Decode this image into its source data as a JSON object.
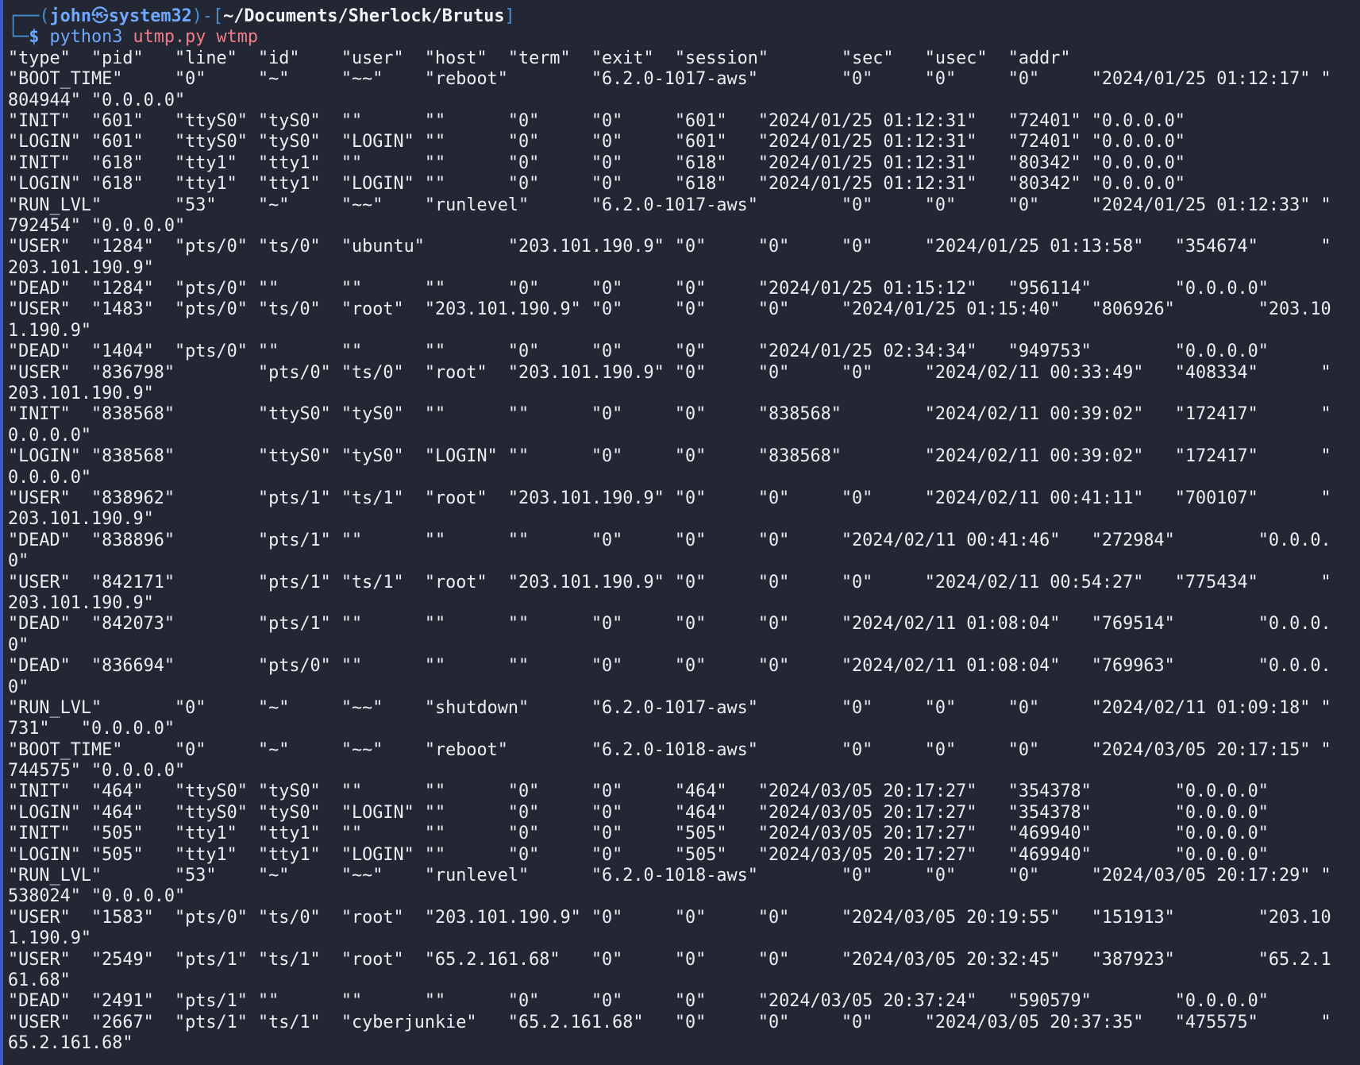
{
  "colors": {
    "background": "#232733",
    "accent_left_border": "#3b58c9",
    "prompt_frame": "#4a8fd0",
    "prompt_user_host": "#6ea8ff",
    "path": "#f2f4f7",
    "command_args": "#f27d8a",
    "output_text": "#eaeef3"
  },
  "prompt": {
    "frame_top_left": "┌──(",
    "user": "john",
    "separator_icon": "㉿",
    "host": "system32",
    "frame_mid": ")-[",
    "path": "~/Documents/Sherlock/Brutus",
    "frame_close": "]",
    "frame_bottom_left": "└─",
    "dollar": "$",
    "command": "python3",
    "arg1": "utmp.py",
    "arg2": "wtmp"
  },
  "output_lines": [
    "\"type\"  \"pid\"   \"line\"  \"id\"    \"user\"  \"host\"  \"term\"  \"exit\"  \"session\"       \"sec\"   \"usec\"  \"addr\"",
    "\"BOOT_TIME\"     \"0\"     \"~\"     \"~~\"    \"reboot\"        \"6.2.0-1017-aws\"        \"0\"     \"0\"     \"0\"     \"2024/01/25 01:12:17\" \"",
    "804944\" \"0.0.0.0\"",
    "\"INIT\"  \"601\"   \"ttyS0\" \"tyS0\"  \"\"      \"\"      \"0\"     \"0\"     \"601\"   \"2024/01/25 01:12:31\"   \"72401\" \"0.0.0.0\"",
    "\"LOGIN\" \"601\"   \"ttyS0\" \"tyS0\"  \"LOGIN\" \"\"      \"0\"     \"0\"     \"601\"   \"2024/01/25 01:12:31\"   \"72401\" \"0.0.0.0\"",
    "\"INIT\"  \"618\"   \"tty1\"  \"tty1\"  \"\"      \"\"      \"0\"     \"0\"     \"618\"   \"2024/01/25 01:12:31\"   \"80342\" \"0.0.0.0\"",
    "\"LOGIN\" \"618\"   \"tty1\"  \"tty1\"  \"LOGIN\" \"\"      \"0\"     \"0\"     \"618\"   \"2024/01/25 01:12:31\"   \"80342\" \"0.0.0.0\"",
    "\"RUN_LVL\"       \"53\"    \"~\"     \"~~\"    \"runlevel\"      \"6.2.0-1017-aws\"        \"0\"     \"0\"     \"0\"     \"2024/01/25 01:12:33\" \"",
    "792454\" \"0.0.0.0\"",
    "\"USER\"  \"1284\"  \"pts/0\" \"ts/0\"  \"ubuntu\"        \"203.101.190.9\" \"0\"     \"0\"     \"0\"     \"2024/01/25 01:13:58\"   \"354674\"      \"",
    "203.101.190.9\"",
    "\"DEAD\"  \"1284\"  \"pts/0\" \"\"      \"\"      \"\"      \"0\"     \"0\"     \"0\"     \"2024/01/25 01:15:12\"   \"956114\"        \"0.0.0.0\"",
    "\"USER\"  \"1483\"  \"pts/0\" \"ts/0\"  \"root\"  \"203.101.190.9\" \"0\"     \"0\"     \"0\"     \"2024/01/25 01:15:40\"   \"806926\"        \"203.10",
    "1.190.9\"",
    "\"DEAD\"  \"1404\"  \"pts/0\" \"\"      \"\"      \"\"      \"0\"     \"0\"     \"0\"     \"2024/01/25 02:34:34\"   \"949753\"        \"0.0.0.0\"",
    "\"USER\"  \"836798\"        \"pts/0\" \"ts/0\"  \"root\"  \"203.101.190.9\" \"0\"     \"0\"     \"0\"     \"2024/02/11 00:33:49\"   \"408334\"      \"",
    "203.101.190.9\"",
    "\"INIT\"  \"838568\"        \"ttyS0\" \"tyS0\"  \"\"      \"\"      \"0\"     \"0\"     \"838568\"        \"2024/02/11 00:39:02\"   \"172417\"      \"",
    "0.0.0.0\"",
    "\"LOGIN\" \"838568\"        \"ttyS0\" \"tyS0\"  \"LOGIN\" \"\"      \"0\"     \"0\"     \"838568\"        \"2024/02/11 00:39:02\"   \"172417\"      \"",
    "0.0.0.0\"",
    "\"USER\"  \"838962\"        \"pts/1\" \"ts/1\"  \"root\"  \"203.101.190.9\" \"0\"     \"0\"     \"0\"     \"2024/02/11 00:41:11\"   \"700107\"      \"",
    "203.101.190.9\"",
    "\"DEAD\"  \"838896\"        \"pts/1\" \"\"      \"\"      \"\"      \"0\"     \"0\"     \"0\"     \"2024/02/11 00:41:46\"   \"272984\"        \"0.0.0.",
    "0\"",
    "\"USER\"  \"842171\"        \"pts/1\" \"ts/1\"  \"root\"  \"203.101.190.9\" \"0\"     \"0\"     \"0\"     \"2024/02/11 00:54:27\"   \"775434\"      \"",
    "203.101.190.9\"",
    "\"DEAD\"  \"842073\"        \"pts/1\" \"\"      \"\"      \"\"      \"0\"     \"0\"     \"0\"     \"2024/02/11 01:08:04\"   \"769514\"        \"0.0.0.",
    "0\"",
    "\"DEAD\"  \"836694\"        \"pts/0\" \"\"      \"\"      \"\"      \"0\"     \"0\"     \"0\"     \"2024/02/11 01:08:04\"   \"769963\"        \"0.0.0.",
    "0\"",
    "\"RUN_LVL\"       \"0\"     \"~\"     \"~~\"    \"shutdown\"      \"6.2.0-1017-aws\"        \"0\"     \"0\"     \"0\"     \"2024/02/11 01:09:18\" \"",
    "731\"   \"0.0.0.0\"",
    "\"BOOT_TIME\"     \"0\"     \"~\"     \"~~\"    \"reboot\"        \"6.2.0-1018-aws\"        \"0\"     \"0\"     \"0\"     \"2024/03/05 20:17:15\" \"",
    "744575\" \"0.0.0.0\"",
    "\"INIT\"  \"464\"   \"ttyS0\" \"tyS0\"  \"\"      \"\"      \"0\"     \"0\"     \"464\"   \"2024/03/05 20:17:27\"   \"354378\"        \"0.0.0.0\"",
    "\"LOGIN\" \"464\"   \"ttyS0\" \"tyS0\"  \"LOGIN\" \"\"      \"0\"     \"0\"     \"464\"   \"2024/03/05 20:17:27\"   \"354378\"        \"0.0.0.0\"",
    "\"INIT\"  \"505\"   \"tty1\"  \"tty1\"  \"\"      \"\"      \"0\"     \"0\"     \"505\"   \"2024/03/05 20:17:27\"   \"469940\"        \"0.0.0.0\"",
    "\"LOGIN\" \"505\"   \"tty1\"  \"tty1\"  \"LOGIN\" \"\"      \"0\"     \"0\"     \"505\"   \"2024/03/05 20:17:27\"   \"469940\"        \"0.0.0.0\"",
    "\"RUN_LVL\"       \"53\"    \"~\"     \"~~\"    \"runlevel\"      \"6.2.0-1018-aws\"        \"0\"     \"0\"     \"0\"     \"2024/03/05 20:17:29\" \"",
    "538024\" \"0.0.0.0\"",
    "\"USER\"  \"1583\"  \"pts/0\" \"ts/0\"  \"root\"  \"203.101.190.9\" \"0\"     \"0\"     \"0\"     \"2024/03/05 20:19:55\"   \"151913\"        \"203.10",
    "1.190.9\"",
    "\"USER\"  \"2549\"  \"pts/1\" \"ts/1\"  \"root\"  \"65.2.161.68\"   \"0\"     \"0\"     \"0\"     \"2024/03/05 20:32:45\"   \"387923\"        \"65.2.1",
    "61.68\"",
    "\"DEAD\"  \"2491\"  \"pts/1\" \"\"      \"\"      \"\"      \"0\"     \"0\"     \"0\"     \"2024/03/05 20:37:24\"   \"590579\"        \"0.0.0.0\"",
    "\"USER\"  \"2667\"  \"pts/1\" \"ts/1\"  \"cyberjunkie\"   \"65.2.161.68\"   \"0\"     \"0\"     \"0\"     \"2024/03/05 20:37:35\"   \"475575\"      \"",
    "65.2.161.68\""
  ]
}
